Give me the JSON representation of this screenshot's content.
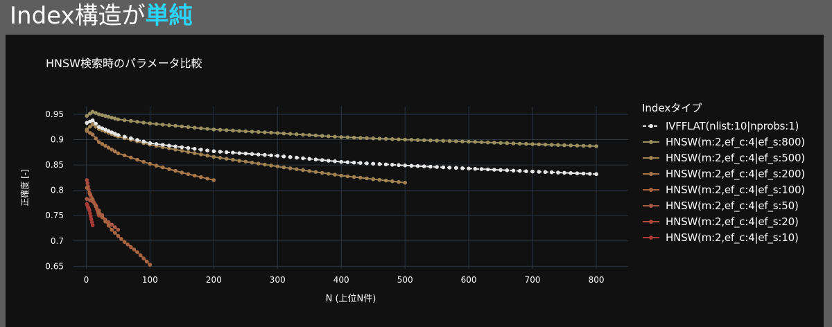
{
  "slide": {
    "title_main": "Index構造が",
    "title_accent": "単純"
  },
  "colors": {
    "background": "#5e5e5e",
    "panel": "#111111",
    "grid": "#283442",
    "accent": "#2ad4ff",
    "text": "#ffffff"
  },
  "chart_data": {
    "type": "line",
    "title": "HNSW検索時のパラメータ比較",
    "xlabel": "N (上位N件)",
    "ylabel": "正確度 [-]",
    "xlim": [
      -20,
      850
    ],
    "ylim": [
      0.645,
      0.965
    ],
    "xticks": [
      0,
      100,
      200,
      300,
      400,
      500,
      600,
      700,
      800
    ],
    "yticks": [
      0.65,
      0.7,
      0.75,
      0.8,
      0.85,
      0.9,
      0.95
    ],
    "grid": true,
    "legend_title": "Indexタイプ",
    "legend_position": "right",
    "series": [
      {
        "name": "IVFFLAT(nlist:10|nprobs:1)",
        "color": "#e6e6e6",
        "dash": true,
        "x": [
          1,
          10,
          20,
          50,
          100,
          200,
          300,
          400,
          500,
          600,
          700,
          800
        ],
        "y": [
          0.933,
          0.938,
          0.925,
          0.909,
          0.893,
          0.877,
          0.868,
          0.856,
          0.849,
          0.843,
          0.837,
          0.832
        ]
      },
      {
        "name": "HNSW(m:2,ef_c:4|ef_s:800)",
        "color": "#9a9060",
        "x": [
          1,
          10,
          20,
          50,
          100,
          200,
          300,
          400,
          500,
          600,
          700,
          800
        ],
        "y": [
          0.947,
          0.955,
          0.95,
          0.94,
          0.932,
          0.92,
          0.913,
          0.905,
          0.9,
          0.896,
          0.891,
          0.887
        ]
      },
      {
        "name": "HNSW(m:2,ef_c:4|ef_s:500)",
        "color": "#a08252",
        "x": [
          1,
          10,
          20,
          50,
          100,
          200,
          300,
          400,
          500
        ],
        "y": [
          0.92,
          0.93,
          0.921,
          0.906,
          0.89,
          0.866,
          0.847,
          0.829,
          0.815
        ]
      },
      {
        "name": "HNSW(m:2,ef_c:4|ef_s:200)",
        "color": "#a8774a",
        "x": [
          1,
          10,
          20,
          50,
          100,
          150,
          200
        ],
        "y": [
          0.917,
          0.91,
          0.895,
          0.873,
          0.852,
          0.835,
          0.82
        ]
      },
      {
        "name": "HNSW(m:2,ef_c:4|ef_s:100)",
        "color": "#a8633f",
        "x": [
          1,
          10,
          20,
          40,
          60,
          80,
          100
        ],
        "y": [
          0.805,
          0.782,
          0.755,
          0.722,
          0.698,
          0.678,
          0.653
        ]
      },
      {
        "name": "HNSW(m:2,ef_c:4|ef_s:50)",
        "color": "#a85a45",
        "x": [
          1,
          10,
          20,
          30,
          40,
          50
        ],
        "y": [
          0.783,
          0.778,
          0.76,
          0.742,
          0.732,
          0.722
        ]
      },
      {
        "name": "HNSW(m:2,ef_c:4|ef_s:20)",
        "color": "#a84a3c",
        "x": [
          1,
          5,
          10,
          15,
          20
        ],
        "y": [
          0.82,
          0.795,
          0.78,
          0.77,
          0.75
        ]
      },
      {
        "name": "HNSW(m:2,ef_c:4|ef_s:10)",
        "color": "#a83b35",
        "x": [
          1,
          5,
          10
        ],
        "y": [
          0.773,
          0.76,
          0.731
        ]
      }
    ]
  }
}
